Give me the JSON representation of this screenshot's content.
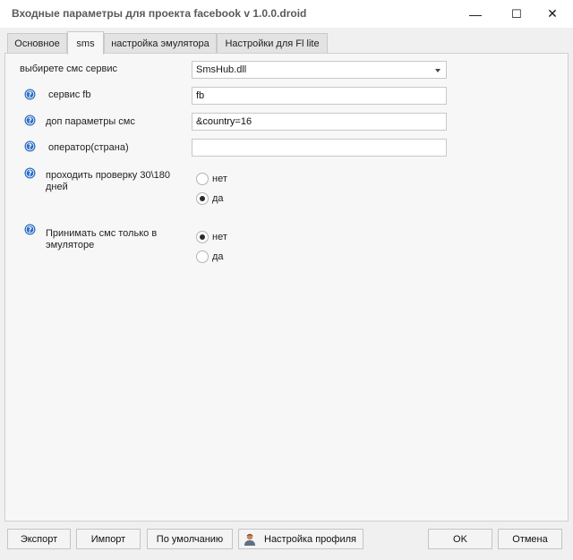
{
  "window": {
    "title": "Входные параметры для проекта facebook v 1.0.0.droid",
    "minimize_glyph": "—",
    "maximize_glyph": "☐",
    "close_glyph": "✕"
  },
  "tabs": [
    {
      "label": "Основное",
      "active": false
    },
    {
      "label": "sms",
      "active": true
    },
    {
      "label": "настройка эмулятора",
      "active": false
    },
    {
      "label": "Настройки для Fl lite",
      "active": false
    }
  ],
  "form": {
    "sms_service": {
      "label": "выбирете смс сервис",
      "value": "SmsHub.dll"
    },
    "fb_service": {
      "label": "сервис fb",
      "value": "fb"
    },
    "sms_params": {
      "label": "доп параметры смс",
      "value": "&country=16"
    },
    "operator": {
      "label": "оператор(страна)",
      "value": ""
    },
    "check_30_180": {
      "label": "проходить проверку 30\\180 дней",
      "options": [
        {
          "label": "нет",
          "checked": false
        },
        {
          "label": "да",
          "checked": true
        }
      ]
    },
    "emulator_only": {
      "label": "Принимать смс только в эмуляторе",
      "options": [
        {
          "label": "нет",
          "checked": true
        },
        {
          "label": "да",
          "checked": false
        }
      ]
    }
  },
  "buttons": {
    "export": "Экспорт",
    "import": "Импорт",
    "default": "По умолчанию",
    "profile": "Настройка профиля",
    "ok": "OK",
    "cancel": "Отмена"
  },
  "icons": {
    "help": "help-icon",
    "profile": "user-icon"
  },
  "colors": {
    "help_icon": "#2f6fc6",
    "title_text": "#5a5a5a"
  }
}
